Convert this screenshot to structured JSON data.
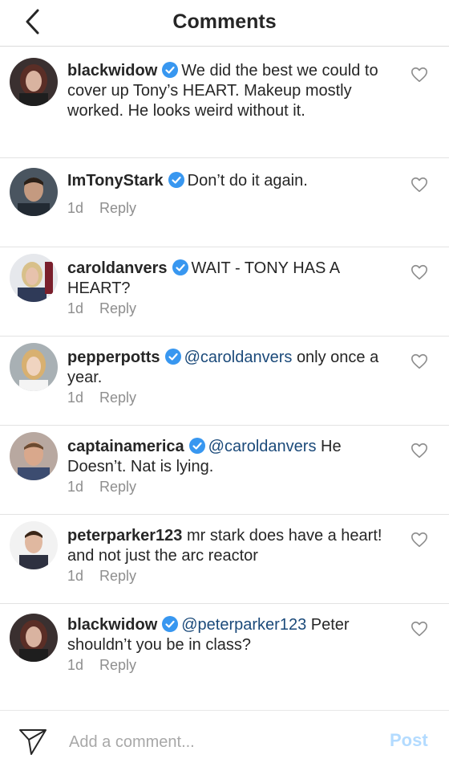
{
  "header": {
    "title": "Comments",
    "back_icon": "chevron-left-icon"
  },
  "comments": [
    {
      "username": "blackwidow",
      "verified": true,
      "mention": "",
      "text": "We did the best we could to cover up Tony’s HEART. Makeup mostly worked. He looks weird without it.",
      "time": "",
      "reply": "",
      "avatar": "blackwidow-avatar"
    },
    {
      "username": "ImTonyStark",
      "verified": true,
      "mention": "",
      "text": "Don’t do it again.",
      "time": "1d",
      "reply": "Reply",
      "avatar": "tony-stark-avatar"
    },
    {
      "username": "caroldanvers",
      "verified": true,
      "mention": "",
      "text": "WAIT - TONY HAS A HEART?",
      "time": "1d",
      "reply": "Reply",
      "avatar": "carol-danvers-avatar"
    },
    {
      "username": "pepperpotts",
      "verified": true,
      "mention": "@caroldanvers",
      "text": "only once a year.",
      "time": "1d",
      "reply": "Reply",
      "avatar": "pepper-potts-avatar"
    },
    {
      "username": "captainamerica",
      "verified": true,
      "mention": "@caroldanvers",
      "text": "He Doesn’t. Nat is lying.",
      "time": "1d",
      "reply": "Reply",
      "avatar": "captain-america-avatar"
    },
    {
      "username": "peterparker123",
      "verified": false,
      "mention": "",
      "text": "mr stark does have a heart! and not just the arc reactor",
      "time": "1d",
      "reply": "Reply",
      "avatar": "peter-parker-avatar"
    },
    {
      "username": "blackwidow",
      "verified": true,
      "mention": "@peterparker123",
      "text": "Peter shouldn’t you be in class?",
      "time": "1d",
      "reply": "Reply",
      "avatar": "blackwidow-avatar"
    }
  ],
  "footer": {
    "placeholder": "Add a comment...",
    "post_label": "Post",
    "send_icon": "paper-plane-icon"
  },
  "colors": {
    "verified": "#3897f0",
    "mention": "#1b4a7a",
    "post_disabled": "#b3dbff",
    "secondary_text": "#8e8e8e"
  }
}
